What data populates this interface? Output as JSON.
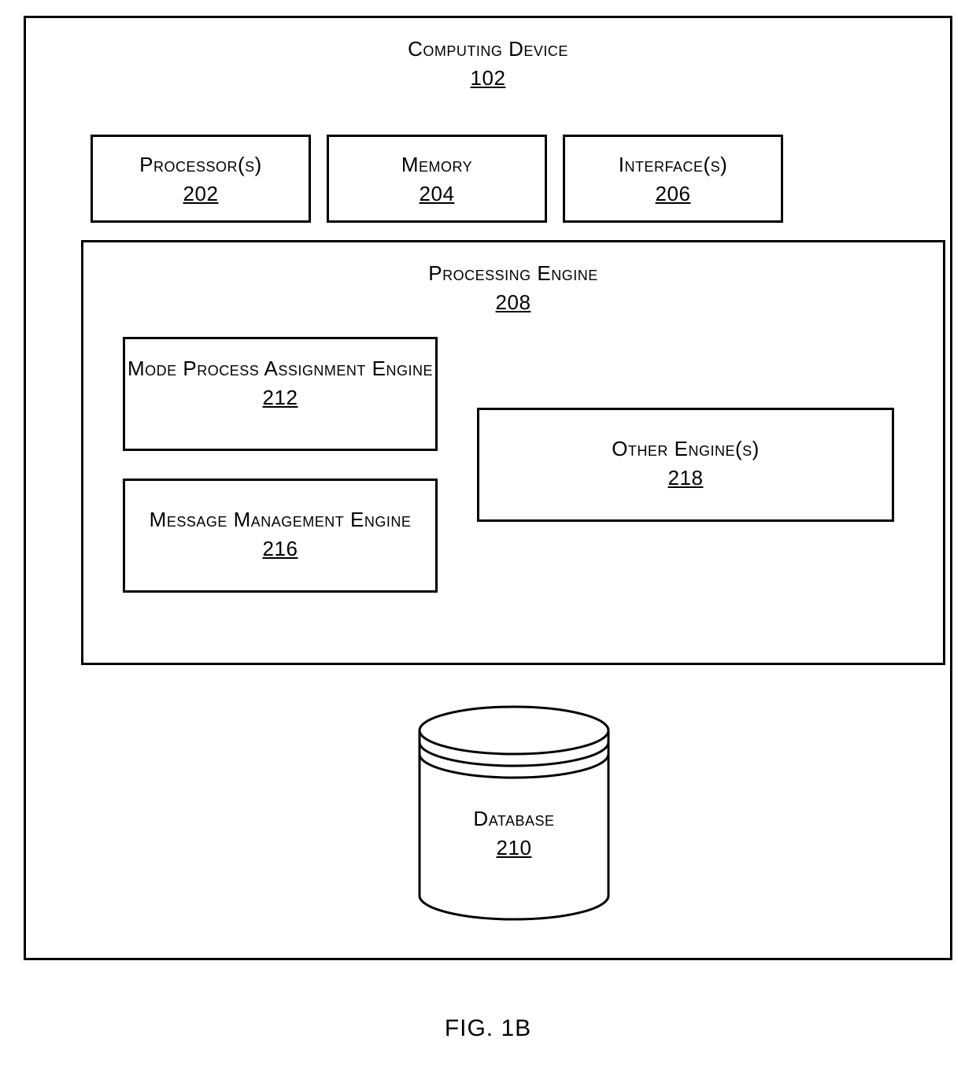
{
  "diagram": {
    "outer": {
      "title": "Computing Device",
      "ref": "102"
    },
    "top": {
      "processor": {
        "title": "Processor(s)",
        "ref": "202"
      },
      "memory": {
        "title": "Memory",
        "ref": "204"
      },
      "interface": {
        "title": "Interface(s)",
        "ref": "206"
      }
    },
    "processing_engine": {
      "title": "Processing Engine",
      "ref": "208",
      "children": {
        "mode_engine": {
          "title": "Mode Process Assignment Engine",
          "ref": "212"
        },
        "message_engine": {
          "title": "Message Management Engine",
          "ref": "216"
        },
        "other_engines": {
          "title": "Other Engine(s)",
          "ref": "218"
        }
      }
    },
    "database": {
      "title": "Database",
      "ref": "210"
    }
  },
  "figure_caption": "FIG. 1B"
}
